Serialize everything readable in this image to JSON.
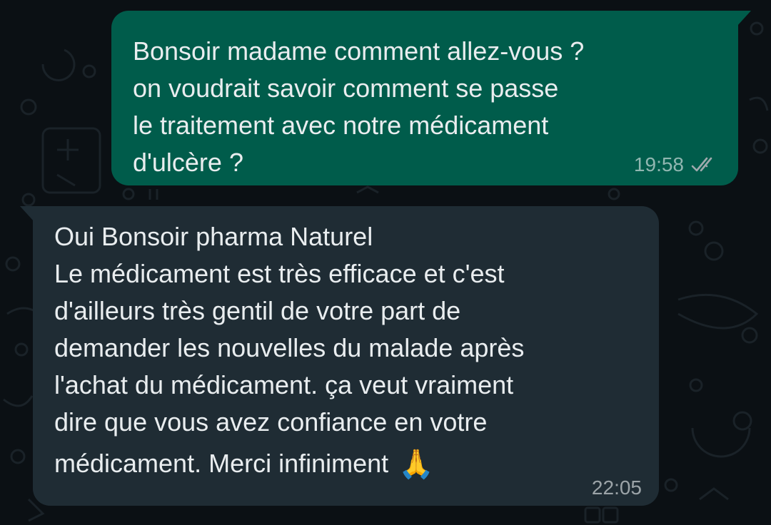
{
  "chat": {
    "messages": [
      {
        "direction": "outgoing",
        "lines": [
          "Bonsoir madame comment allez-vous ?",
          "on voudrait savoir comment se passe",
          "le traitement avec notre médicament",
          "d'ulcère ?"
        ],
        "time": "19:58",
        "status_icon": "double-check-icon"
      },
      {
        "direction": "incoming",
        "lines": [
          "Oui Bonsoir pharma Naturel",
          "Le médicament est très efficace et c'est",
          "d'ailleurs très gentil de votre part de",
          "demander les nouvelles du malade après",
          "l'achat du médicament. ça veut vraiment",
          "dire que vous avez confiance en votre",
          "médicament. Merci infiniment"
        ],
        "emoji": "🙏",
        "time": "22:05"
      }
    ]
  },
  "colors": {
    "background": "#0b1014",
    "outgoing_bubble": "#005c4b",
    "incoming_bubble": "#1f2c34",
    "text": "#e9edef",
    "meta_text": "#9fa9ad"
  }
}
